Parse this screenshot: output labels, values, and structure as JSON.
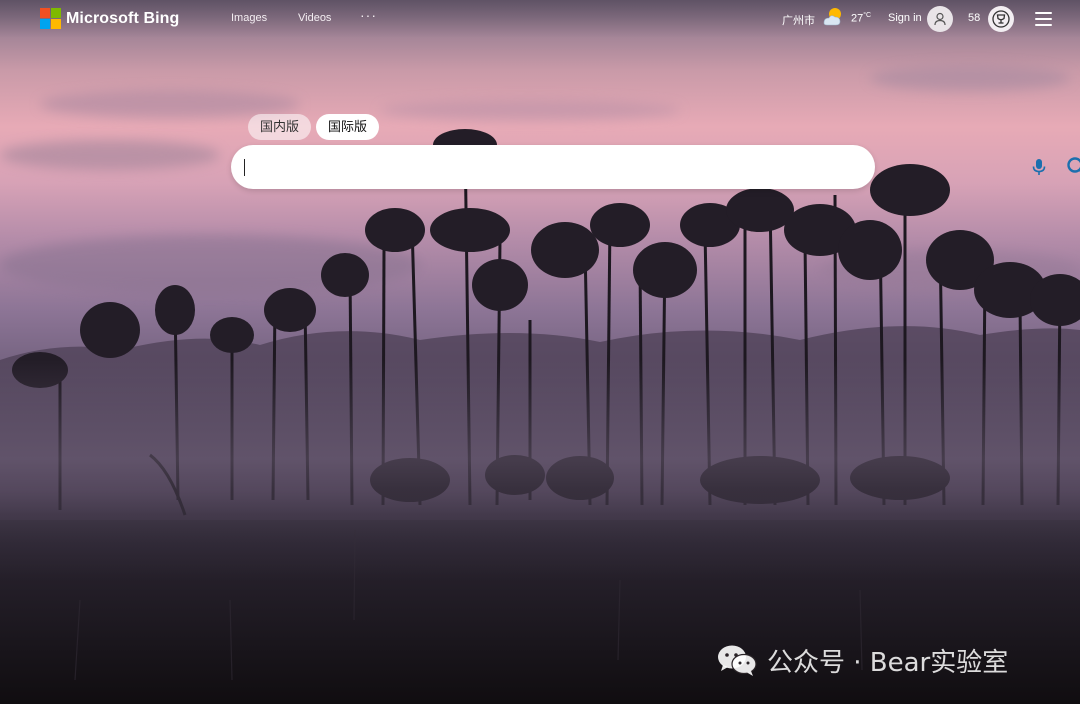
{
  "header": {
    "logo_text": "Microsoft Bing",
    "nav": [
      "Images",
      "Videos"
    ],
    "more": "···",
    "location": "广州市",
    "temperature": "27",
    "temperature_unit": "°C",
    "sign_in": "Sign in",
    "rewards_points": "58"
  },
  "search": {
    "tabs": [
      "国内版",
      "国际版"
    ],
    "active_tab": "国际版",
    "value": "",
    "placeholder": ""
  },
  "watermark": {
    "text": "公众号 · Bear实验室"
  },
  "icons": [
    "microsoft-logo-icon",
    "weather-partly-cloudy-icon",
    "user-icon",
    "rewards-trophy-icon",
    "hamburger-menu-icon",
    "microphone-icon",
    "search-icon",
    "wechat-icon"
  ],
  "colors": {
    "ms_red": "#f25022",
    "ms_green": "#7fba00",
    "ms_blue": "#00a4ef",
    "ms_yellow": "#ffb900",
    "search_icon": "#1b6fae"
  }
}
